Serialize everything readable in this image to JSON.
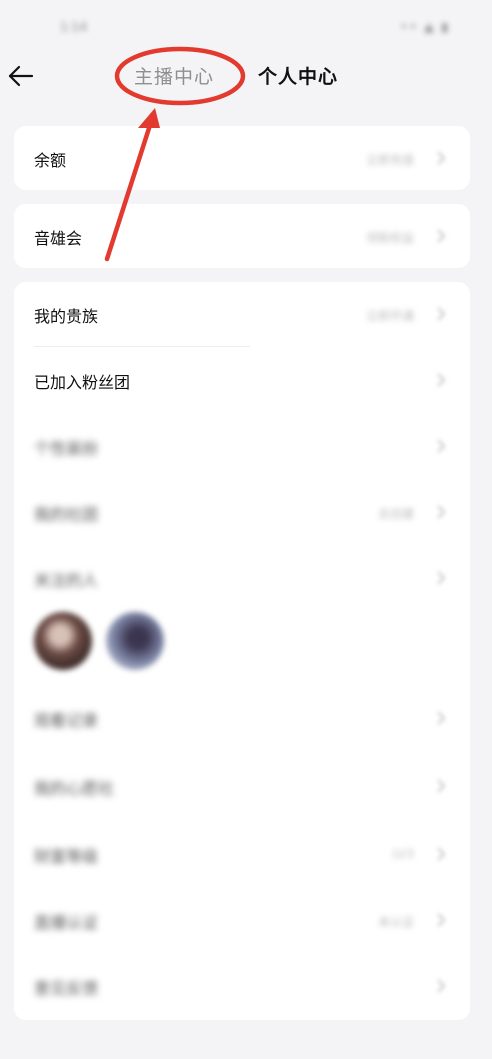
{
  "status_bar": {
    "time": "1:14",
    "icons": "•• ▲ ▮"
  },
  "header": {
    "tabs": [
      {
        "label": "主播中心"
      },
      {
        "label": "个人中心"
      }
    ]
  },
  "card_balance": {
    "label": "余额",
    "value": "立即充值"
  },
  "card_union": {
    "label": "音雄会",
    "value": "领取权益"
  },
  "list": {
    "items": [
      {
        "label": "我的贵族",
        "value": "立即开通"
      },
      {
        "label": "已加入粉丝团",
        "value": ""
      },
      {
        "label": "个性装扮",
        "value": ""
      },
      {
        "label": "我的社团",
        "value": "去创建"
      },
      {
        "label": "关注的人",
        "value": ""
      },
      {
        "label": "观看记录",
        "value": ""
      },
      {
        "label": "我的心愿社",
        "value": ""
      },
      {
        "label": "财富等级",
        "value": "LV3"
      },
      {
        "label": "直播认证",
        "value": "未认证"
      },
      {
        "label": "意见反馈",
        "value": ""
      }
    ]
  },
  "colors": {
    "annotation_red": "#e23a2e",
    "background": "#f4f4f6",
    "card": "#ffffff"
  }
}
